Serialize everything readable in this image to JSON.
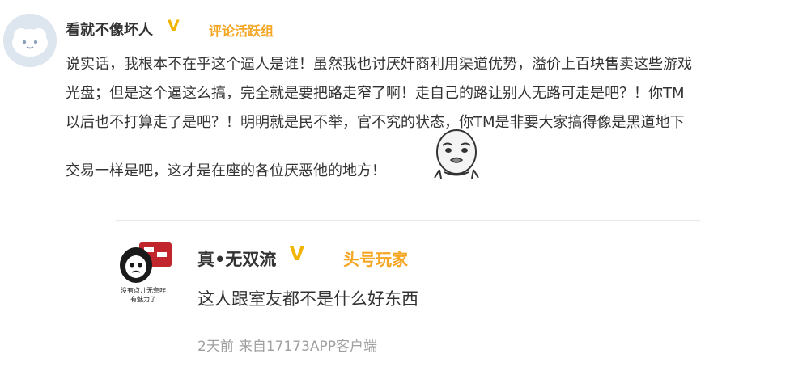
{
  "comment": {
    "username": "看就不像坏人",
    "verified_mark": "V",
    "badge": "评论活跃组",
    "lines": [
      "说实话，我根本不在乎这个逼人是谁！虽然我也讨厌奸商利用渠道优势，溢价上百块售卖这些游戏",
      "光盘；但是这个逼这么搞，完全就是要把路走窄了啊！走自己的路让别人无路可走是吧？！你TM",
      "以后也不打算走了是吧？！明明就是民不举，官不究的状态，你TM是非要大家搞得像是黑道地下",
      "交易一样是吧，这才是在座的各位厌恶他的地方！"
    ]
  },
  "reply": {
    "username": "真•无双流",
    "verified_mark": "V",
    "badge": "头号玩家",
    "text": "这人跟室友都不是什么好东西",
    "time": "2天前",
    "source": "来自17173APP客户端",
    "avatar_caption_1": "没有点儿无奈咋",
    "avatar_caption_2": "有魅力了"
  },
  "colors": {
    "badge": "#f5a623",
    "verified": "#f2b400",
    "meta": "#a0a0a0"
  },
  "icons": {
    "main_avatar": "default-cloud-avatar-icon",
    "sticker": "meme-face-sticker-icon",
    "reply_avatar": "panda-meme-avatar"
  }
}
